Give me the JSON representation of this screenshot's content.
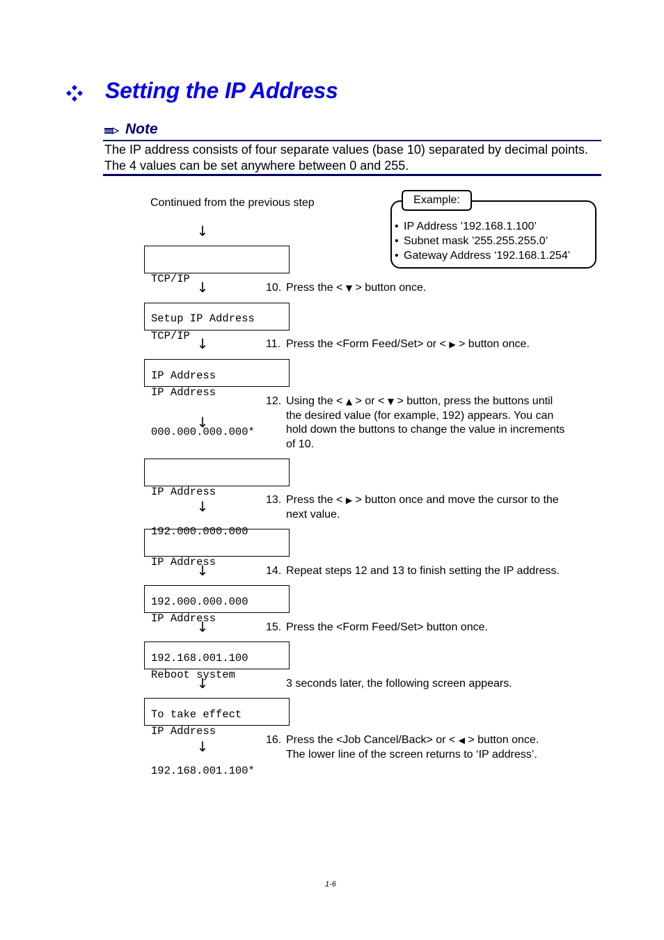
{
  "heading": {
    "icon": "four-diamond-bullet-icon",
    "title": "Setting the IP Address"
  },
  "note": {
    "icon": "pencil-icon",
    "label": "Note",
    "text": "The IP address consists of four separate values (base 10) separated by decimal points.  The 4 values can be set anywhere between 0 and 255."
  },
  "example": {
    "label": "Example:",
    "items": [
      "IP Address ’192.168.1.100’",
      "Subnet mask ’255.255.255.0’",
      "Gateway Address ‘192.168.1.254’"
    ]
  },
  "flow": {
    "intro": "Continued from the previous step",
    "arrow_glyph": "↓",
    "screens": [
      {
        "line1": "TCP/IP",
        "line2": "Setup IP Address"
      },
      {
        "line1": "TCP/IP",
        "line2": "IP Address"
      },
      {
        "line1": "IP Address",
        "line2": "000.000.000.000*"
      },
      {
        "line1": "IP Address",
        "line2": "192.000.000.000"
      },
      {
        "line1": "IP Address",
        "line2": "192.000.000.000"
      },
      {
        "line1": "IP Address",
        "line2": "192.168.001.100"
      },
      {
        "line1": "Reboot system",
        "line2": "To take effect"
      },
      {
        "line1": "IP Address",
        "line2": "192.168.001.100*"
      }
    ],
    "steps": [
      {
        "num": "10.",
        "parts": [
          "Press the < ",
          "▼",
          " > button once."
        ]
      },
      {
        "num": "11.",
        "parts": [
          "Press the <Form Feed/Set> or < ",
          "▶",
          " > button once."
        ]
      },
      {
        "num": "12.",
        "parts": [
          "Using the < ",
          "▲",
          " > or < ",
          "▼",
          " > button, press the buttons until"
        ],
        "continuation": [
          "the desired value (for example, 192) appears. You can",
          "hold down the buttons to change the value in increments",
          "of 10."
        ]
      },
      {
        "num": "13.",
        "parts": [
          "Press the < ",
          "▶",
          " > button once and move the cursor to the"
        ],
        "continuation": [
          "next value."
        ]
      },
      {
        "num": "14.",
        "parts": [
          "Repeat steps 12 and 13 to finish setting the IP address."
        ]
      },
      {
        "num": "15.",
        "parts": [
          "Press the <Form Feed/Set> button once."
        ]
      },
      {
        "num": "",
        "parts": [
          "3 seconds later, the following screen appears."
        ]
      },
      {
        "num": "16.",
        "parts": [
          "Press the <Job Cancel/Back> or < ",
          "◀",
          " > button once."
        ],
        "continuation": [
          "The lower line of the screen returns to ‘IP address’."
        ]
      }
    ]
  },
  "footer": {
    "page_number": "1-6"
  }
}
